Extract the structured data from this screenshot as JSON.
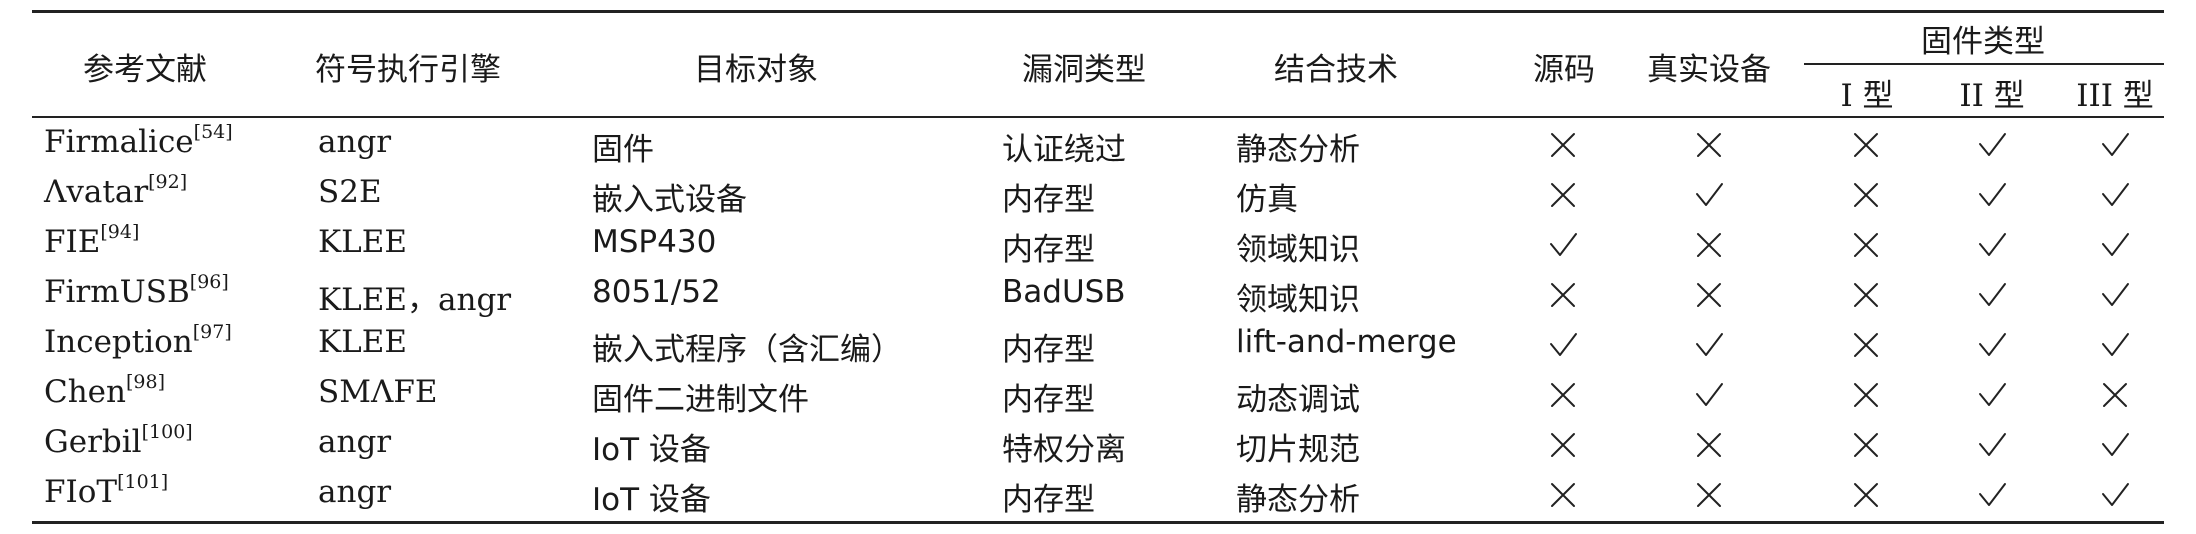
{
  "headers": {
    "ref": "参考文献",
    "engine": "符号执行引擎",
    "target": "目标对象",
    "vuln": "漏洞类型",
    "tech": "结合技术",
    "source": "源码",
    "device": "真实设备",
    "fw_type": "固件类型",
    "type1": "I 型",
    "type2": "II 型",
    "type3": "III 型"
  },
  "rows": [
    {
      "name": "Firmalice",
      "ref": "[54]",
      "engine": "angr",
      "target": "固件",
      "vuln": "认证绕过",
      "tech": "静态分析",
      "source": "×",
      "device": "×",
      "t1": "×",
      "t2": "✓",
      "t3": "✓"
    },
    {
      "name": "Λvatar",
      "ref": "[92]",
      "engine": "S2E",
      "target": "嵌入式设备",
      "vuln": "内存型",
      "tech": "仿真",
      "source": "×",
      "device": "✓",
      "t1": "×",
      "t2": "✓",
      "t3": "✓"
    },
    {
      "name": "FIE",
      "ref": "[94]",
      "engine": "KLEE",
      "target": "MSP430",
      "vuln": "内存型",
      "tech": "领域知识",
      "source": "✓",
      "device": "×",
      "t1": "×",
      "t2": "✓",
      "t3": "✓"
    },
    {
      "name": "FirmUSB",
      "ref": "[96]",
      "engine": "KLEE，angr",
      "target": "8051/52",
      "vuln": "BadUSB",
      "tech": "领域知识",
      "source": "×",
      "device": "×",
      "t1": "×",
      "t2": "✓",
      "t3": "✓"
    },
    {
      "name": "Inception",
      "ref": "[97]",
      "engine": "KLEE",
      "target": "嵌入式程序（含汇编）",
      "vuln": "内存型",
      "tech": "lift-and-merge",
      "source": "✓",
      "device": "✓",
      "t1": "×",
      "t2": "✓",
      "t3": "✓"
    },
    {
      "name": "Chen",
      "ref": "[98]",
      "engine": "SMΛFE",
      "target": "固件二进制文件",
      "vuln": "内存型",
      "tech": "动态调试",
      "source": "×",
      "device": "✓",
      "t1": "×",
      "t2": "✓",
      "t3": "×"
    },
    {
      "name": "Gerbil",
      "ref": "[100]",
      "engine": "angr",
      "target": "IoT 设备",
      "vuln": "特权分离",
      "tech": "切片规范",
      "source": "×",
      "device": "×",
      "t1": "×",
      "t2": "✓",
      "t3": "✓"
    },
    {
      "name": "FIoT",
      "ref": "[101]",
      "engine": "angr",
      "target": "IoT 设备",
      "vuln": "内存型",
      "tech": "静态分析",
      "source": "×",
      "device": "×",
      "t1": "×",
      "t2": "✓",
      "t3": "✓"
    }
  ]
}
